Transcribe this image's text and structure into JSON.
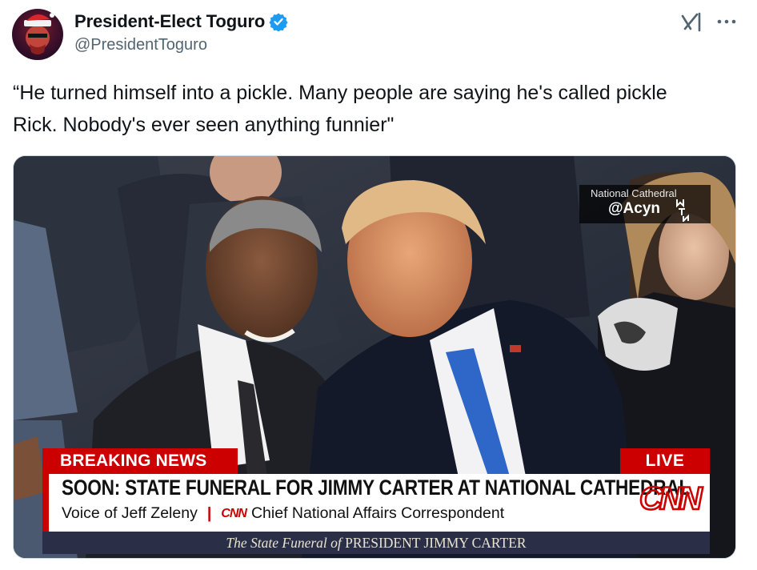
{
  "tweet": {
    "display_name": "President-Elect Toguro",
    "handle": "@PresidentToguro",
    "text": "“He turned himself into a pickle. Many people are saying he's called pickle Rick. Nobody's ever seen anything funnier\""
  },
  "icons": {
    "verified": "verified-badge",
    "grok": "grok-icon",
    "more": "more-icon"
  },
  "colors": {
    "verified_blue": "#1d9bf0",
    "cnn_red": "#cc0000",
    "handle_gray": "#536471"
  },
  "media": {
    "watermark_location": "National Cathedral",
    "watermark_handle": "@Acyn",
    "breaking_label": "BREAKING NEWS",
    "live_label": "LIVE",
    "headline": "SOON: STATE FUNERAL FOR JIMMY CARTER AT NATIONAL CATHEDRAL",
    "voice_of": "Voice of Jeff Zeleny",
    "network_small": "CNN",
    "correspondent": "Chief National Affairs Correspondent",
    "network_logo": "CNN",
    "funeral_italic": "The State Funeral of",
    "funeral_name": "PRESIDENT JIMMY CARTER"
  }
}
